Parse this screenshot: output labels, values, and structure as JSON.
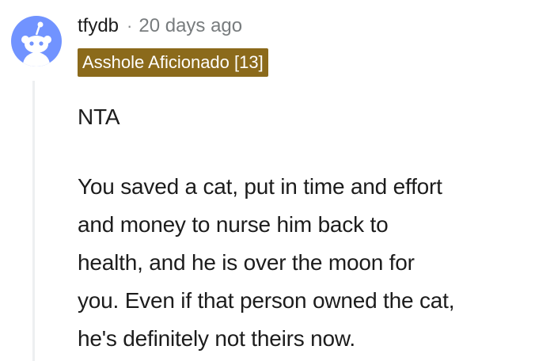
{
  "comment": {
    "username": "tfydb",
    "separator": "·",
    "timestamp": "20 days ago",
    "flair": "Asshole Aficionado [13]",
    "paragraphs": [
      {
        "lines": [
          "NTA"
        ]
      },
      {
        "lines": [
          "You saved a cat, put in time and effort",
          "and money to nurse him back to",
          "health, and he is over the moon for",
          "you. Even if that person owned the cat,",
          "he's definitely not theirs now."
        ]
      }
    ]
  },
  "colors": {
    "avatar_bg": "#7193ff",
    "flair_bg": "#8b6a1b",
    "thread_line": "#edeff1"
  },
  "icons": {
    "avatar": "snoo-avatar-icon"
  }
}
